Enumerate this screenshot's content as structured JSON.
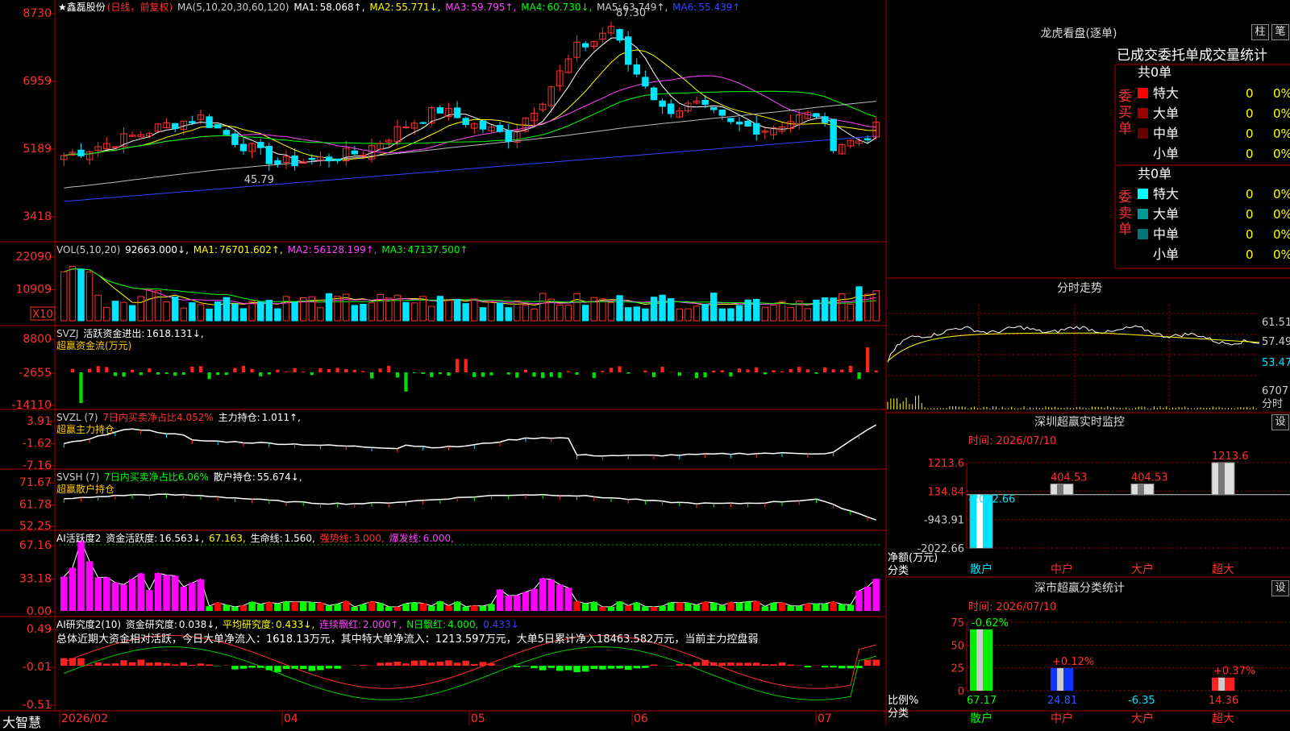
{
  "stock": {
    "name": "★鑫磊股份",
    "period": "(日线，前复权)",
    "ma_label": "MA(5,10,20,30,60,120)",
    "ma": [
      {
        "label": "MA1:",
        "value": "58.068↑,",
        "color": "#ffffff"
      },
      {
        "label": "MA2:",
        "value": "55.771↓,",
        "color": "#ffff00"
      },
      {
        "label": "MA3:",
        "value": "59.795↑,",
        "color": "#ff44ff"
      },
      {
        "label": "MA4:",
        "value": "60.730↓,",
        "color": "#00ff00"
      },
      {
        "label": "MA5:",
        "value": "63.749↑,",
        "color": "#bbbbbb"
      },
      {
        "label": "MA6:",
        "value": "55.439↑",
        "color": "#3344ff"
      }
    ],
    "y_ticks": [
      "8730",
      "6959",
      "5189",
      "3418"
    ],
    "high_label": "87.30",
    "low_label": "45.79"
  },
  "volume": {
    "header": "VOL(5,10,20)",
    "value": "92663.000↓,",
    "ma": [
      {
        "label": "MA1:",
        "value": "76701.602↑,",
        "color": "#ffff00"
      },
      {
        "label": "MA2:",
        "value": "56128.199↑,",
        "color": "#ff44ff"
      },
      {
        "label": "MA3:",
        "value": "47137.500↑",
        "color": "#00ff00"
      }
    ],
    "y_ticks": [
      "22090",
      "10909"
    ],
    "unit": "X10"
  },
  "svzj": {
    "header": "SVZJ",
    "text1": "活跃资金进出:",
    "value": "1618.131↓,",
    "subtitle": "超赢资金流(万元)",
    "y_ticks": [
      "8800",
      "-2655",
      "-14110"
    ]
  },
  "svzl": {
    "header": "SVZL (7)",
    "t1": "7日内买卖净占比4.052%",
    "t2": "主力持仓:",
    "value": "1.011↑,",
    "subtitle": "超赢主力持仓",
    "y_ticks": [
      "3.91",
      "-1.62",
      "-7.16"
    ]
  },
  "svsh": {
    "header": "SVSH (7)",
    "t1": "7日内买卖净占比6.06%",
    "t2": "散户持仓:",
    "value": "55.674↓,",
    "subtitle": "超赢散户持仓",
    "y_ticks": [
      "71.67",
      "61.78",
      "52.25"
    ]
  },
  "ai_active": {
    "header": "AI活跃度2",
    "t1": "资金活跃度:",
    "value": "16.563↓,",
    "v2": "67.163,",
    "t3": "生命线:",
    "v3": "1.560,",
    "t4": "强势线:",
    "v4": "3.000,",
    "t5": "爆发线:",
    "v5": "6.000,",
    "y_ticks": [
      "67.16",
      "33.18",
      "0.00"
    ]
  },
  "ai_research": {
    "header": "AI研究度2(10)",
    "t1": "资金研究度:",
    "value": "0.038↓,",
    "t2": "平均研究度:",
    "v2": "0.433↓,",
    "t3": "连续飘红:",
    "v3": "2.000↑,",
    "t4": "N日飘红:",
    "v4": "4.000,",
    "v5": "0.433↓",
    "summary": "总体近期大资金相对活跃，今日大单净流入：1618.13万元，其中特大单净流入：1213.597万元，大单5日累计净入18463.582万元，当前主力控盘弱",
    "y_ticks": [
      "0.49",
      "-0.01",
      "-0.51"
    ]
  },
  "x_axis": {
    "labels": [
      "2026/02",
      "04",
      "05",
      "06",
      "07"
    ],
    "brand": "大智慧"
  },
  "longhu": {
    "title": "龙虎看盘(逐单)",
    "tab_zhu": "柱",
    "tab_bi": "笔",
    "subtitle": "已成交委托单成交量统计",
    "buy_label": "委买单",
    "sell_label": "委卖单",
    "buy_total": "共0单",
    "sell_total": "共0单",
    "buy_rows": [
      {
        "name": "特大",
        "count": "0",
        "pct": "0%",
        "color": "#ff0000"
      },
      {
        "name": "大单",
        "count": "0",
        "pct": "0%",
        "color": "#990000"
      },
      {
        "name": "中单",
        "count": "0",
        "pct": "0%",
        "color": "#660000"
      },
      {
        "name": "小单",
        "count": "0",
        "pct": "0%",
        "color": ""
      }
    ],
    "sell_rows": [
      {
        "name": "特大",
        "count": "0",
        "pct": "0%",
        "color": "#00ffff"
      },
      {
        "name": "大单",
        "count": "0",
        "pct": "0%",
        "color": "#009999"
      },
      {
        "name": "中单",
        "count": "0",
        "pct": "0%",
        "color": "#007777"
      },
      {
        "name": "小单",
        "count": "0",
        "pct": "0%",
        "color": ""
      }
    ]
  },
  "intraday": {
    "title": "分时走势",
    "y_labels": [
      "61.51",
      "57.49",
      "53.47"
    ],
    "vol_label": "6707",
    "vol_unit": "分时"
  },
  "sz_monitor": {
    "title": "深圳超赢实时监控",
    "set": "设",
    "time": "时间: 2026/07/10",
    "y_ticks": [
      "1213.6",
      "134.84",
      "-943.91",
      "-2022.66"
    ],
    "y_label": "净额(万元)",
    "x_label": "分类",
    "categories": [
      "散户",
      "中户",
      "大户",
      "超大"
    ],
    "values": [
      -2022.66,
      404.53,
      404.53,
      1213.6
    ],
    "value_labels": [
      "-2022.66",
      "404.53",
      "404.53",
      "1213.6"
    ]
  },
  "sz_class": {
    "title": "深市超赢分类统计",
    "set": "设",
    "time": "时间: 2026/07/10",
    "y_ticks": [
      "75",
      "50",
      "25",
      "0"
    ],
    "y_label": "比例%",
    "x_label": "分类",
    "categories": [
      "散户",
      "中户",
      "大户",
      "超大"
    ],
    "values": [
      67.17,
      24.81,
      -6.35,
      14.36
    ],
    "changes": [
      "-0.62%",
      "+0.12%",
      "",
      "+0.37%"
    ]
  },
  "chart_data": [
    {
      "type": "candlestick",
      "title": "鑫磊股份 日线",
      "ylim": [
        34.18,
        87.3
      ],
      "high": 87.3,
      "low": 45.79,
      "x_labels": [
        "2026/02",
        "04",
        "05",
        "06",
        "07"
      ]
    },
    {
      "type": "bar",
      "title": "深圳超赢实时监控",
      "categories": [
        "散户",
        "中户",
        "大户",
        "超大"
      ],
      "values": [
        -2022.66,
        404.53,
        404.53,
        1213.6
      ],
      "ylim": [
        -2022.66,
        1213.6
      ]
    },
    {
      "type": "bar",
      "title": "深市超赢分类统计",
      "categories": [
        "散户",
        "中户",
        "大户",
        "超大"
      ],
      "values": [
        67.17,
        24.81,
        -6.35,
        14.36
      ],
      "ylim": [
        0,
        75
      ]
    }
  ]
}
